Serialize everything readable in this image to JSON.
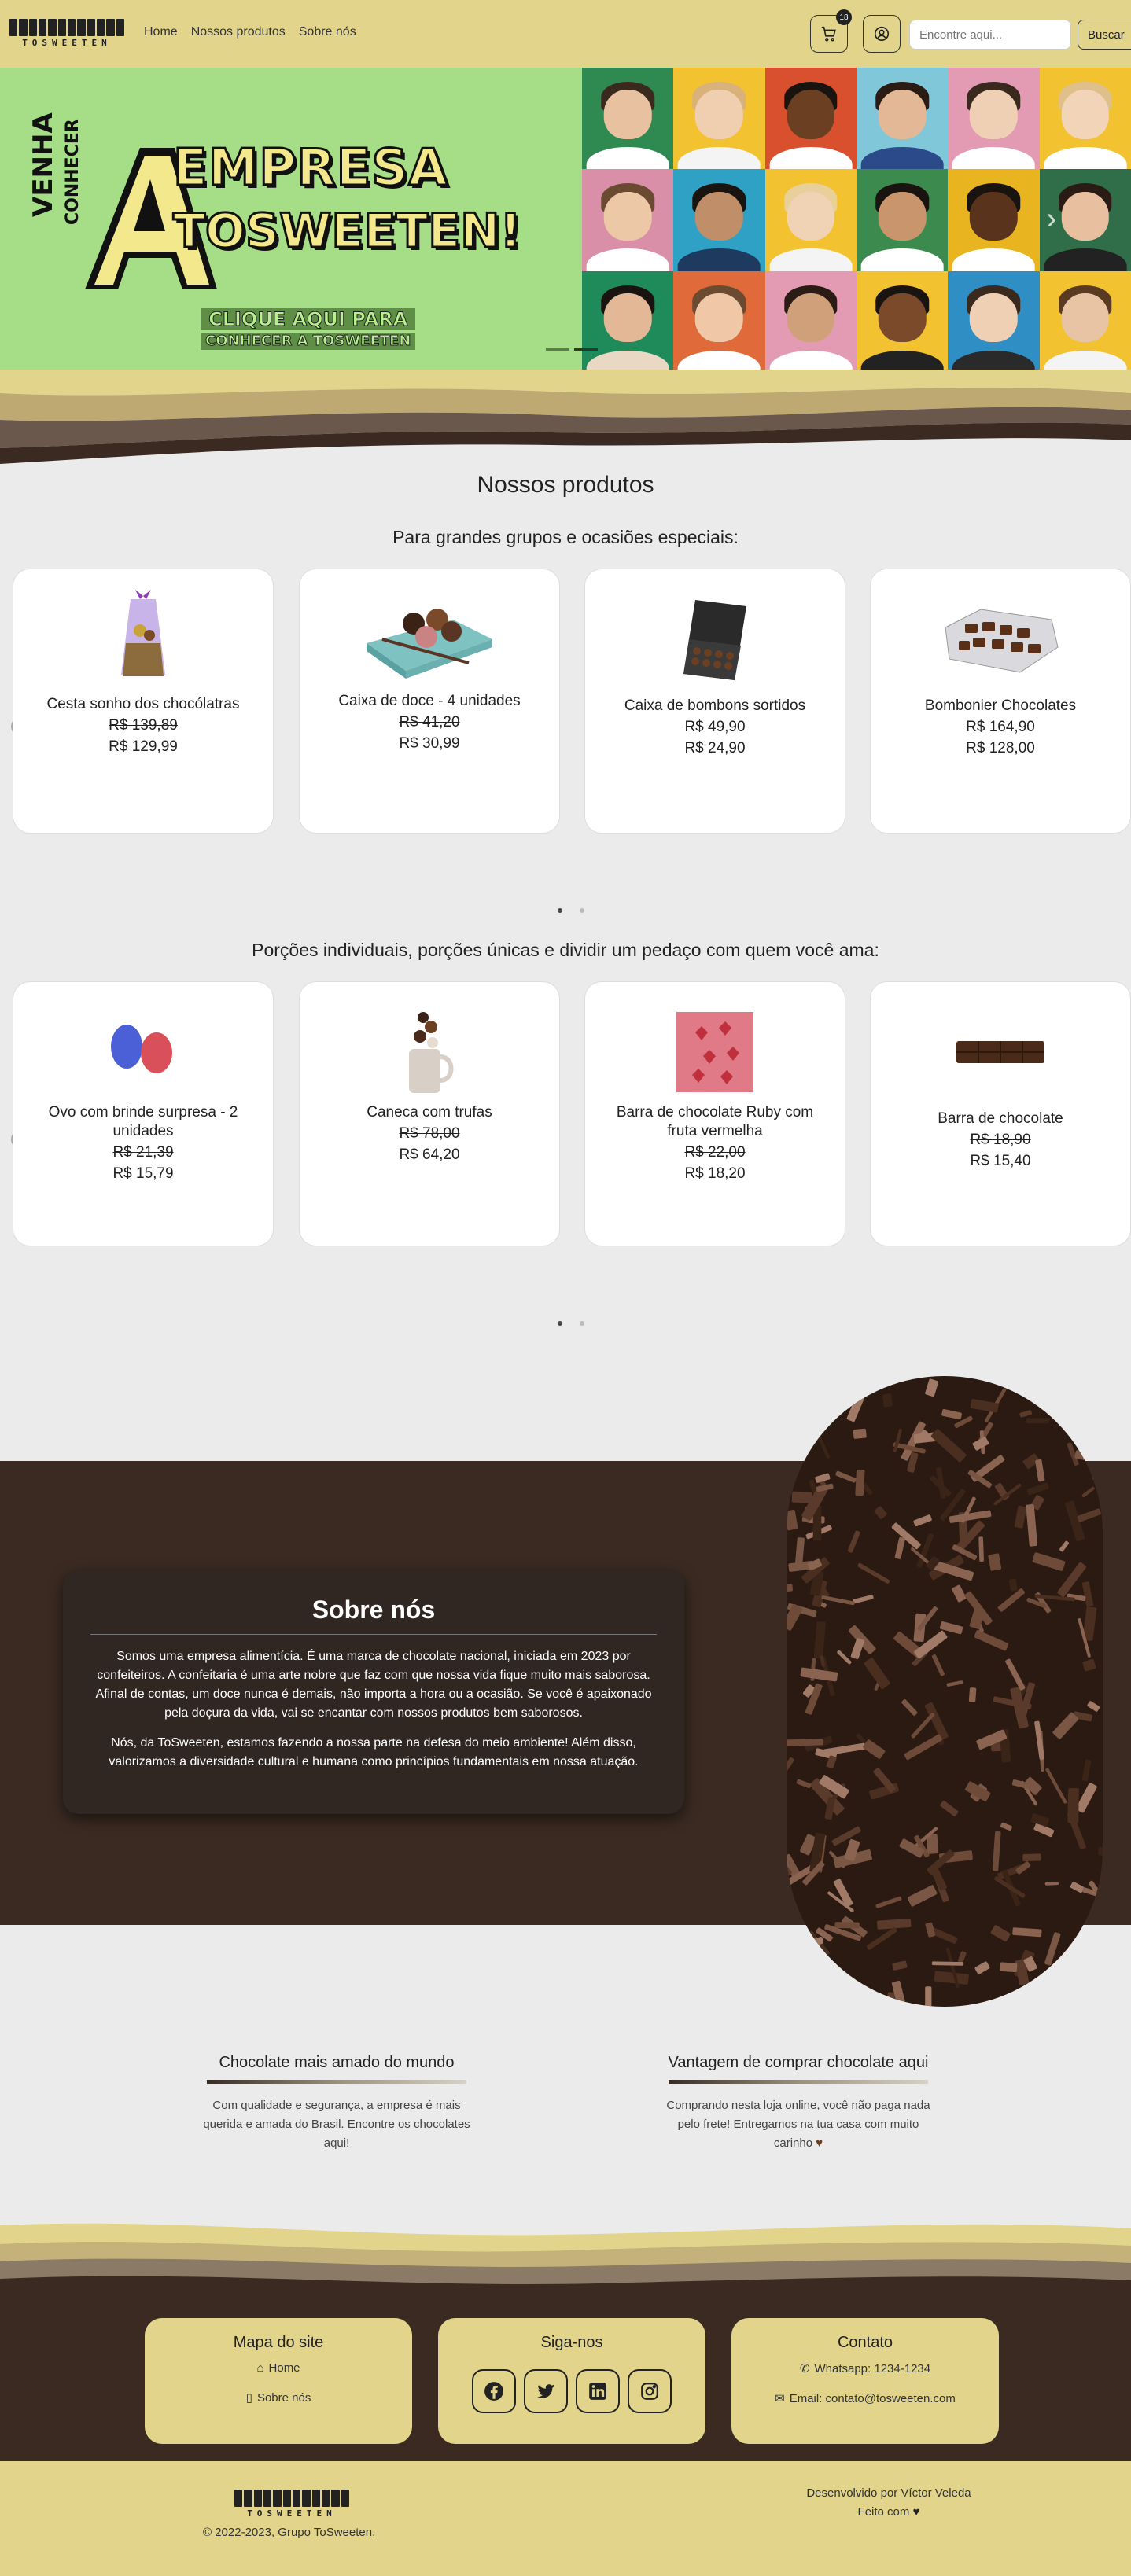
{
  "brand": {
    "logo_text": "TOSWEETEN",
    "accent": "#e2d58b",
    "dark": "#3a2a22",
    "hero_green": "#a6de87"
  },
  "nav": {
    "links": [
      "Home",
      "Nossos produtos",
      "Sobre nós"
    ],
    "cart_count": "18",
    "search_placeholder": "Encontre aqui...",
    "search_button": "Buscar"
  },
  "hero": {
    "vertical_1": "VENHA",
    "vertical_2": "CONHECER",
    "big_letter": "A",
    "title_1": "EMPRESA",
    "title_2": "TOSWEETEN!",
    "cta_1": "CLIQUE AQUI PARA",
    "cta_2": "CONHECER A TOSWEETEN",
    "slides": 2,
    "active_slide": 2
  },
  "products": {
    "title": "Nossos produtos",
    "groups": [
      {
        "subtitle": "Para grandes grupos e ocasiões especiais:",
        "items": [
          {
            "name": "Cesta sonho dos chocólatras",
            "old": "R$ 139,89",
            "new": "R$ 129,99",
            "icon": "gift-basket"
          },
          {
            "name": "Caixa de doce - 4 unidades",
            "old": "R$ 41,20",
            "new": "R$ 30,99",
            "icon": "cupcake-box"
          },
          {
            "name": "Caixa de bombons sortidos",
            "old": "R$ 49,90",
            "new": "R$ 24,90",
            "icon": "bonbon-box"
          },
          {
            "name": "Bombonier Chocolates",
            "old": "R$ 164,90",
            "new": "R$ 128,00",
            "icon": "bombonier"
          }
        ]
      },
      {
        "subtitle": "Porções individuais, porções únicas e dividir um pedaço com quem você ama:",
        "items": [
          {
            "name": "Ovo com brinde surpresa - 2 unidades",
            "old": "R$ 21,39",
            "new": "R$ 15,79",
            "icon": "easter-eggs"
          },
          {
            "name": "Caneca com trufas",
            "old": "R$ 78,00",
            "new": "R$ 64,20",
            "icon": "mug-truffles"
          },
          {
            "name": "Barra de chocolate Ruby com fruta vermelha",
            "old": "R$ 22,00",
            "new": "R$ 18,20",
            "icon": "ruby-bar"
          },
          {
            "name": "Barra de chocolate",
            "old": "R$ 18,90",
            "new": "R$ 15,40",
            "icon": "chocolate-bar"
          }
        ]
      }
    ]
  },
  "about": {
    "title": "Sobre nós",
    "p1": "Somos uma empresa alimentícia. É uma marca de chocolate nacional, iniciada em 2023 por confeiteiros. A confeitaria é uma arte nobre que faz com que nossa vida fique muito mais saborosa. Afinal de contas, um doce nunca é demais, não importa a hora ou a ocasião. Se você é apaixonado pela doçura da vida, vai se encantar com nossos produtos bem saborosos.",
    "p2": "Nós, da ToSweeten, estamos fazendo a nossa parte na defesa do meio ambiente! Além disso, valorizamos a diversidade cultural e humana como princípios fundamentais em nossa atuação."
  },
  "features": [
    {
      "title": "Chocolate mais amado do mundo",
      "text": "Com qualidade e segurança, a empresa é mais querida e amada do Brasil. Encontre os chocolates aqui!"
    },
    {
      "title": "Vantagem de comprar chocolate aqui",
      "text": "Comprando nesta loja online, você não paga nada pelo frete! Entregamos na tua casa com muito carinho"
    }
  ],
  "footer": {
    "sitemap": {
      "title": "Mapa do site",
      "home": "Home",
      "about": "Sobre nós"
    },
    "social": {
      "title": "Siga-nos",
      "icons": [
        "facebook-icon",
        "twitter-icon",
        "linkedin-icon",
        "instagram-icon"
      ]
    },
    "contact": {
      "title": "Contato",
      "whatsapp": "Whatsapp: 1234-1234",
      "email": "Email: contato@tosweeten.com"
    },
    "copyright": "© 2022-2023, Grupo ToSweeten.",
    "dev": "Desenvolvido por Víctor Veleda",
    "made": "Feito com"
  }
}
